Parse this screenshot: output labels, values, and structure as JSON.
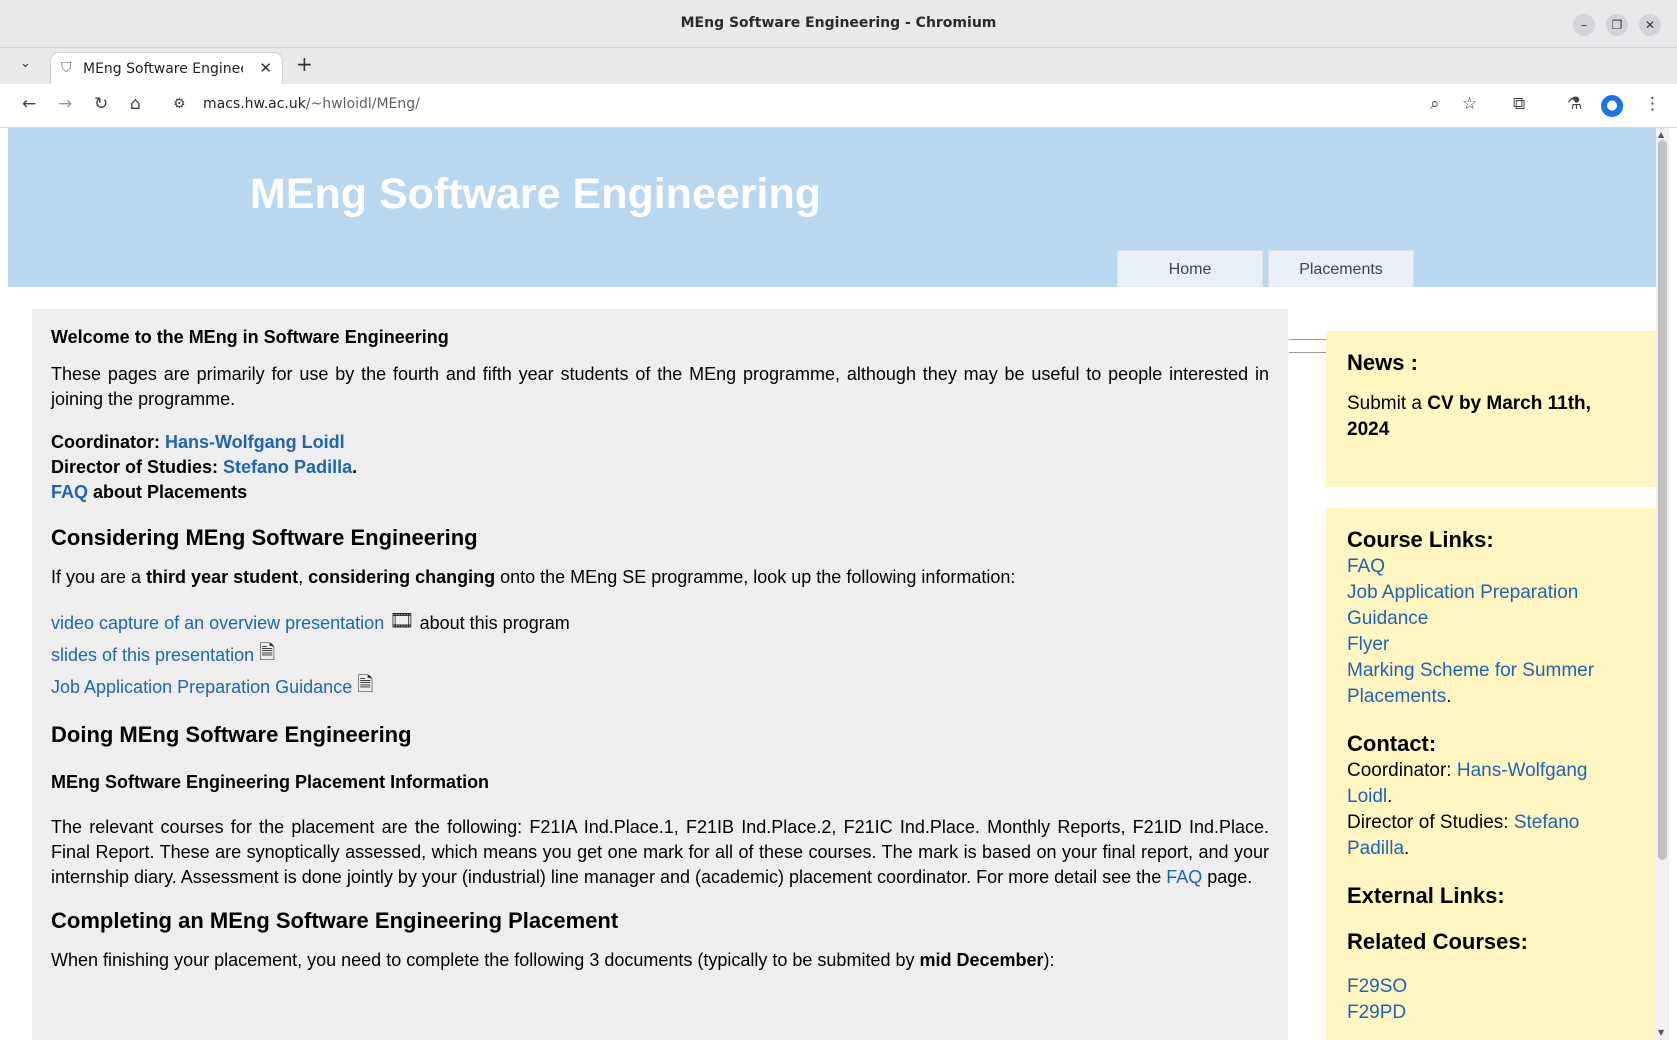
{
  "window": {
    "title": "MEng Software Engineering - Chromium",
    "tab_title": "MEng Software Engineering"
  },
  "toolbar": {
    "url_domain": "macs.hw.ac.uk",
    "url_path": "/~hwloidl/MEng/"
  },
  "page": {
    "site_title": "MEng Software Engineering",
    "nav": [
      "Home",
      "Placements"
    ],
    "welcome_heading": "Welcome to the MEng in Software Engineering",
    "intro": "These pages are primarily for use by the fourth and fifth year students of the MEng programme, although they may be useful to people interested in joining the programme.",
    "coordinator_label": "Coordinator:",
    "coordinator_name": "Hans-Wolfgang Loidl",
    "director_label": "Director of Studies:",
    "director_name": "Stefano Padilla",
    "faq_link": "FAQ",
    "faq_suffix": "about Placements",
    "considering_heading": "Considering MEng Software Engineering",
    "considering_p1": "If you are a ",
    "considering_b1": "third year student",
    "considering_p2": ", ",
    "considering_b2": "considering changing",
    "considering_p3": " onto the MEng SE programme, look up the following information:",
    "video_link": "video capture of an overview presentation",
    "video_suffix": "about this program",
    "slides_link": "slides of this presentation",
    "guidance_link": "Job Application Preparation Guidance",
    "doing_heading": "Doing MEng Software Engineering",
    "placement_info_heading": "MEng Software Engineering Placement Information",
    "placement_text": "The relevant courses for the placement are the following: F21IA Ind.Place.1, F21IB Ind.Place.2, F21IC Ind.Place. Monthly Reports, F21ID Ind.Place. Final Report. These are synoptically assessed, which means you get one mark for all of these courses. The mark is based on your final report, and your internship diary. Assessment is done jointly by your (industrial) line manager and (academic) placement coordinator. For more detail see the ",
    "placement_faq_link": "FAQ",
    "placement_text_end": " page.",
    "completing_heading": "Completing an MEng Software Engineering Placement",
    "completing_p1": "When finishing your placement, you need to complete the following 3 documents (typically to be submited by ",
    "completing_b1": "mid December",
    "completing_p2": "):"
  },
  "sidebar": {
    "news_heading": "News :",
    "news_p1": "Submit a ",
    "news_b1": "CV by March 11th, 2024",
    "course_links_heading": "Course Links:",
    "course_links": [
      "FAQ",
      "Job Application Preparation Guidance",
      "Flyer",
      "Marking Scheme for Summer Placements"
    ],
    "contact_heading": "Contact:",
    "contact_coordinator_label": "Coordinator: ",
    "contact_coordinator_name": "Hans-Wolfgang Loidl",
    "contact_director_label": "Director of Studies: ",
    "contact_director_name": "Stefano Padilla",
    "external_links_heading": "External Links:",
    "related_courses_heading": "Related Courses:",
    "related_courses": [
      "F29SO",
      "F29PD"
    ]
  },
  "icons": {
    "favicon": "shield-icon",
    "video": "film-icon",
    "document": "document-icon"
  },
  "colors": {
    "banner": "#b9d7ee",
    "main_bg": "#eeeeee",
    "sidebar_bg": "#fff6c2",
    "link": "#1f64b3"
  }
}
